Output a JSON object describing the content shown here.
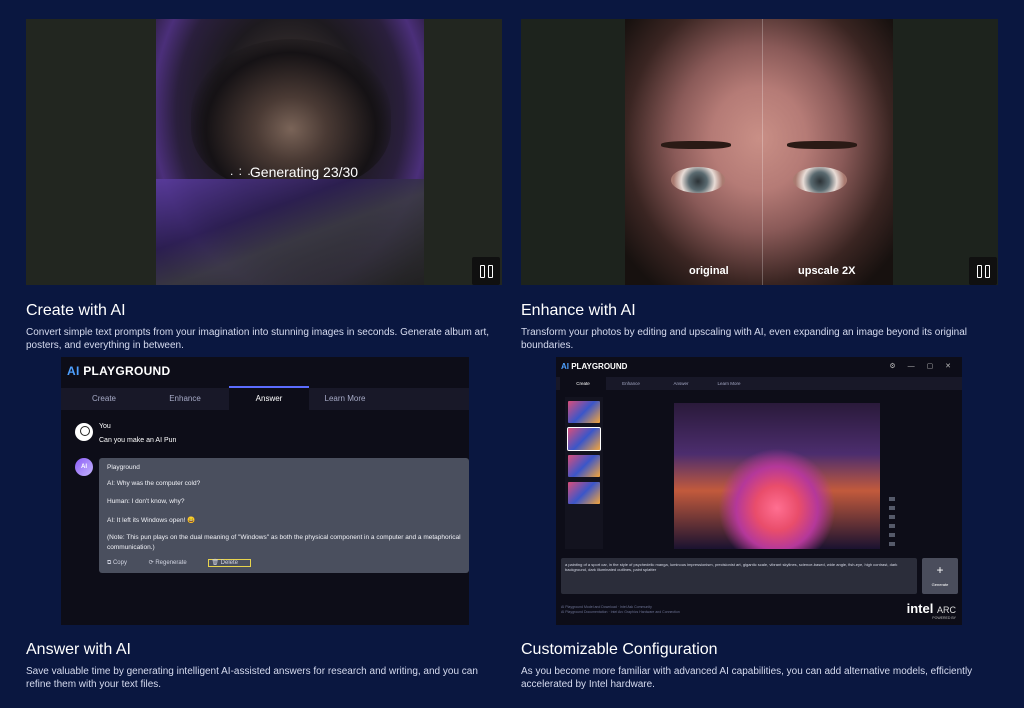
{
  "sections": [
    {
      "title": "Create with AI",
      "desc_line1": "Convert simple text prompts from your imagination into stunning images in seconds. Generate album art,",
      "desc_line2": "posters, and everything in between."
    },
    {
      "title": "Enhance with AI",
      "desc_line1": "Transform your photos by editing and upscaling with AI, even expanding an image beyond its original",
      "desc_line2": "boundaries."
    },
    {
      "title": "Answer with AI",
      "desc_line1": "Save valuable time by generating intelligent AI-assisted answers for research and writing, and you can",
      "desc_line2": "refine them with your text files."
    },
    {
      "title": "Customizable Configuration",
      "desc_line1": "As you become more familiar with advanced AI capabilities, you can add alternative models, efficiently",
      "desc_line2": "accelerated by Intel hardware."
    }
  ],
  "create_media": {
    "generating_text": "Generating 23/30",
    "dots": ". : ."
  },
  "enhance_media": {
    "label_left": "original",
    "label_right": "upscale 2X"
  },
  "answer_app": {
    "brand_ai": "AI",
    "brand_rest": " PLAYGROUND",
    "tabs": [
      "Create",
      "Enhance",
      "Answer",
      "Learn More"
    ],
    "active_tab": "Answer",
    "user_name": "You",
    "user_message": "Can you make an AI Pun",
    "bot_avatar": "AI",
    "bot_name": "Playground",
    "bot_lines": [
      "AI: Why was the computer cold?",
      "Human: I don't know, why?",
      "AI: It left its Windows open! 😄",
      "(Note: This pun plays on the dual meaning of \"Windows\" as both the physical component in a computer and a metaphorical",
      "communication.)"
    ],
    "actions": [
      "Copy",
      "Regenerate",
      "Delete"
    ]
  },
  "config_app": {
    "brand_ai": "AI",
    "brand_rest": " PLAYGROUND",
    "window_buttons": "⚙ — ▢ ✕",
    "tabs": [
      "Create",
      "Enhance",
      "Answer",
      "Learn More"
    ],
    "active_tab": "Create",
    "prompt_text": "a painting of a sport car, in the style of psychedelic manga, luminous impressionism, precisionist art, gigantic scale, vibrant skylines, science-based, wide angle, fish-eye, high contrast, dark background, dark illuminated outlines, paint splatter",
    "generate_plus": "+",
    "generate_label": "Generate",
    "footer_line1": "AI Playground Model and Download · Intel Ask Community",
    "footer_line2": "AI Playground Documentation · Intel Arc Graphics Hardware and Connection",
    "intel_brand": "intel",
    "arc_text": "ARC",
    "powered_by": "POWERED BY"
  },
  "icons": {
    "pause": "pause-icon",
    "user": "user-avatar-icon",
    "bot": "ai-avatar-icon"
  },
  "colors": {
    "background": "#0a1740",
    "accent": "#4ea0ff",
    "active_tab_border": "#5b6cff",
    "delete_highlight": "#e8d44d"
  }
}
